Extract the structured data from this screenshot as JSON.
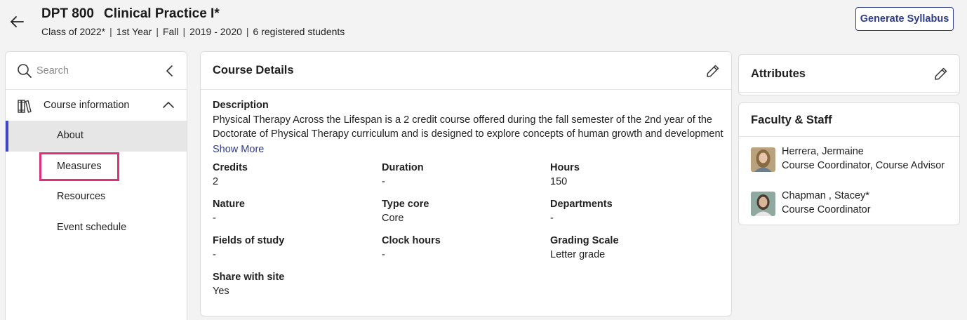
{
  "header": {
    "code": "DPT 800",
    "name": "Clinical Practice I*",
    "meta": [
      "Class of 2022*",
      "1st Year",
      "Fall",
      "2019 - 2020",
      "6 registered students"
    ],
    "generate_label": "Generate Syllabus"
  },
  "sidebar": {
    "search_placeholder": "Search",
    "section_label": "Course information",
    "items": [
      {
        "label": "About"
      },
      {
        "label": "Measures"
      },
      {
        "label": "Resources"
      },
      {
        "label": "Event schedule"
      }
    ]
  },
  "course_details": {
    "title": "Course Details",
    "description_label": "Description",
    "description": "Physical Therapy Across the Lifespan is a 2 credit course offered during the fall semester of the 2nd year of the Doctorate of Physical Therapy curriculum and is designed to explore concepts of human growth and development across the lifespan.",
    "show_more": "Show More",
    "fields": [
      {
        "label": "Credits",
        "value": "2"
      },
      {
        "label": "Duration",
        "value": "-"
      },
      {
        "label": "Hours",
        "value": "150"
      },
      {
        "label": "Nature",
        "value": "-"
      },
      {
        "label": "Type core",
        "value": "Core"
      },
      {
        "label": "Departments",
        "value": "-"
      },
      {
        "label": "Fields of study",
        "value": "-"
      },
      {
        "label": "Clock hours",
        "value": "-"
      },
      {
        "label": "Grading Scale",
        "value": "Letter grade"
      },
      {
        "label": "Share with site",
        "value": "Yes"
      }
    ]
  },
  "attributes": {
    "title": "Attributes"
  },
  "faculty": {
    "title": "Faculty & Staff",
    "people": [
      {
        "name": "Herrera, Jermaine",
        "role": "Course Coordinator, Course Advisor"
      },
      {
        "name": "Chapman , Stacey*",
        "role": "Course Coordinator"
      }
    ]
  },
  "colors": {
    "accent": "#2f3c8a",
    "active_bar": "#3d47c9",
    "highlight": "#e0307c"
  }
}
